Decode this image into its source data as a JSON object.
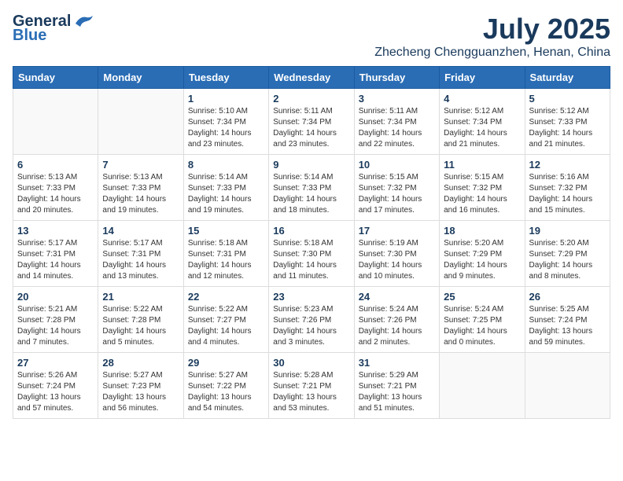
{
  "logo": {
    "line1": "General",
    "line2": "Blue"
  },
  "title": "July 2025",
  "location": "Zhecheng Chengguanzhen, Henan, China",
  "headers": [
    "Sunday",
    "Monday",
    "Tuesday",
    "Wednesday",
    "Thursday",
    "Friday",
    "Saturday"
  ],
  "weeks": [
    [
      {
        "day": "",
        "info": ""
      },
      {
        "day": "",
        "info": ""
      },
      {
        "day": "1",
        "info": "Sunrise: 5:10 AM\nSunset: 7:34 PM\nDaylight: 14 hours and 23 minutes."
      },
      {
        "day": "2",
        "info": "Sunrise: 5:11 AM\nSunset: 7:34 PM\nDaylight: 14 hours and 23 minutes."
      },
      {
        "day": "3",
        "info": "Sunrise: 5:11 AM\nSunset: 7:34 PM\nDaylight: 14 hours and 22 minutes."
      },
      {
        "day": "4",
        "info": "Sunrise: 5:12 AM\nSunset: 7:34 PM\nDaylight: 14 hours and 21 minutes."
      },
      {
        "day": "5",
        "info": "Sunrise: 5:12 AM\nSunset: 7:33 PM\nDaylight: 14 hours and 21 minutes."
      }
    ],
    [
      {
        "day": "6",
        "info": "Sunrise: 5:13 AM\nSunset: 7:33 PM\nDaylight: 14 hours and 20 minutes."
      },
      {
        "day": "7",
        "info": "Sunrise: 5:13 AM\nSunset: 7:33 PM\nDaylight: 14 hours and 19 minutes."
      },
      {
        "day": "8",
        "info": "Sunrise: 5:14 AM\nSunset: 7:33 PM\nDaylight: 14 hours and 19 minutes."
      },
      {
        "day": "9",
        "info": "Sunrise: 5:14 AM\nSunset: 7:33 PM\nDaylight: 14 hours and 18 minutes."
      },
      {
        "day": "10",
        "info": "Sunrise: 5:15 AM\nSunset: 7:32 PM\nDaylight: 14 hours and 17 minutes."
      },
      {
        "day": "11",
        "info": "Sunrise: 5:15 AM\nSunset: 7:32 PM\nDaylight: 14 hours and 16 minutes."
      },
      {
        "day": "12",
        "info": "Sunrise: 5:16 AM\nSunset: 7:32 PM\nDaylight: 14 hours and 15 minutes."
      }
    ],
    [
      {
        "day": "13",
        "info": "Sunrise: 5:17 AM\nSunset: 7:31 PM\nDaylight: 14 hours and 14 minutes."
      },
      {
        "day": "14",
        "info": "Sunrise: 5:17 AM\nSunset: 7:31 PM\nDaylight: 14 hours and 13 minutes."
      },
      {
        "day": "15",
        "info": "Sunrise: 5:18 AM\nSunset: 7:31 PM\nDaylight: 14 hours and 12 minutes."
      },
      {
        "day": "16",
        "info": "Sunrise: 5:18 AM\nSunset: 7:30 PM\nDaylight: 14 hours and 11 minutes."
      },
      {
        "day": "17",
        "info": "Sunrise: 5:19 AM\nSunset: 7:30 PM\nDaylight: 14 hours and 10 minutes."
      },
      {
        "day": "18",
        "info": "Sunrise: 5:20 AM\nSunset: 7:29 PM\nDaylight: 14 hours and 9 minutes."
      },
      {
        "day": "19",
        "info": "Sunrise: 5:20 AM\nSunset: 7:29 PM\nDaylight: 14 hours and 8 minutes."
      }
    ],
    [
      {
        "day": "20",
        "info": "Sunrise: 5:21 AM\nSunset: 7:28 PM\nDaylight: 14 hours and 7 minutes."
      },
      {
        "day": "21",
        "info": "Sunrise: 5:22 AM\nSunset: 7:28 PM\nDaylight: 14 hours and 5 minutes."
      },
      {
        "day": "22",
        "info": "Sunrise: 5:22 AM\nSunset: 7:27 PM\nDaylight: 14 hours and 4 minutes."
      },
      {
        "day": "23",
        "info": "Sunrise: 5:23 AM\nSunset: 7:26 PM\nDaylight: 14 hours and 3 minutes."
      },
      {
        "day": "24",
        "info": "Sunrise: 5:24 AM\nSunset: 7:26 PM\nDaylight: 14 hours and 2 minutes."
      },
      {
        "day": "25",
        "info": "Sunrise: 5:24 AM\nSunset: 7:25 PM\nDaylight: 14 hours and 0 minutes."
      },
      {
        "day": "26",
        "info": "Sunrise: 5:25 AM\nSunset: 7:24 PM\nDaylight: 13 hours and 59 minutes."
      }
    ],
    [
      {
        "day": "27",
        "info": "Sunrise: 5:26 AM\nSunset: 7:24 PM\nDaylight: 13 hours and 57 minutes."
      },
      {
        "day": "28",
        "info": "Sunrise: 5:27 AM\nSunset: 7:23 PM\nDaylight: 13 hours and 56 minutes."
      },
      {
        "day": "29",
        "info": "Sunrise: 5:27 AM\nSunset: 7:22 PM\nDaylight: 13 hours and 54 minutes."
      },
      {
        "day": "30",
        "info": "Sunrise: 5:28 AM\nSunset: 7:21 PM\nDaylight: 13 hours and 53 minutes."
      },
      {
        "day": "31",
        "info": "Sunrise: 5:29 AM\nSunset: 7:21 PM\nDaylight: 13 hours and 51 minutes."
      },
      {
        "day": "",
        "info": ""
      },
      {
        "day": "",
        "info": ""
      }
    ]
  ]
}
